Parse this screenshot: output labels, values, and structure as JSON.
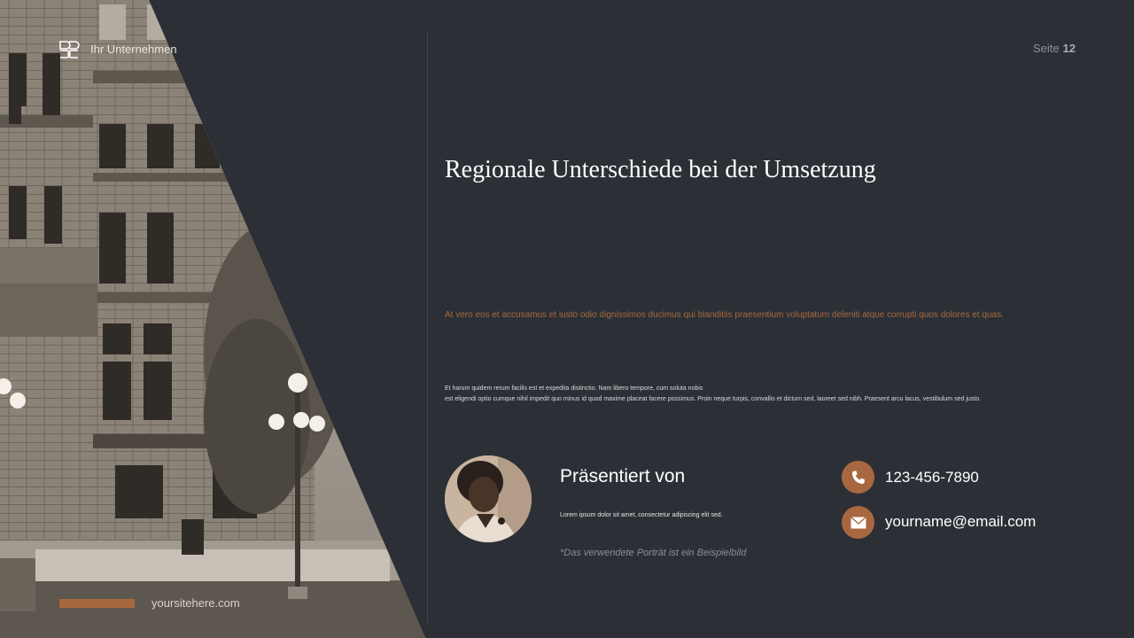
{
  "header": {
    "company": "Ihr Unternehmen",
    "page_label": "Seite",
    "page_number": "12"
  },
  "main": {
    "title": "Regionale Unterschiede bei der Umsetzung",
    "accent_text": "At vero eos et accusamus et iusto odio dignissimos ducimus qui blanditiis praesentium voluptatum deleniti atque corrupti quos dolores et quas.",
    "body_line1": "Et harum quidem rerum facilis est et expedita distinctio. Nam libero tempore, cum soluta nobis",
    "body_line2": "est eligendi optio cumque nihil impedit quo minus id quod maxime placeat facere possimus. Proin neque turpis, convallis et dictum sed, laoreet sed nibh. Praesent arcu lacus, vestibulum sed justo."
  },
  "presenter": {
    "heading": "Präsentiert von",
    "text": "Lorem ipsum dolor sit amet, consectetur adipiscing elit sed.",
    "disclaimer": "*Das verwendete Porträt ist ein Beispielbild"
  },
  "contact": {
    "phone": "123-456-7890",
    "email": "yourname@email.com",
    "phone_icon": "phone-icon",
    "email_icon": "envelope-icon"
  },
  "footer": {
    "website": "yoursitehere.com"
  },
  "colors": {
    "background": "#2c3036",
    "accent": "#a8683f"
  }
}
